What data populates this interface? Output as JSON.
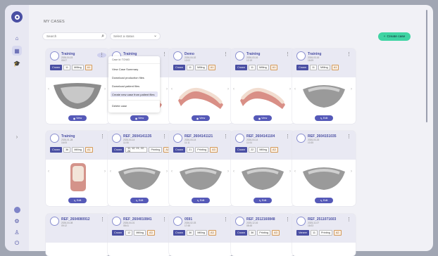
{
  "page": {
    "title": "MY CASES"
  },
  "toolbar": {
    "search_placeholder": "Search",
    "status_placeholder": "Select a status",
    "create_label": "Create case"
  },
  "sidebar": {
    "top_icons": [
      "home-icon",
      "grid-icon",
      "graduation-icon"
    ],
    "bottom_icons": [
      "avatar-icon",
      "settings-icon",
      "user-icon",
      "power-icon"
    ],
    "collapse_icon": "chevron-right-icon"
  },
  "context_menu": {
    "case_id": "Case id: TCN63",
    "items": [
      "View Case Summary",
      "Download production files",
      "Download patient files",
      "Create new case from patient files",
      "Delete case"
    ]
  },
  "cards": [
    {
      "name": "Training",
      "date": "2026-04-15\n09:07",
      "tags": [
        [
          "Crown",
          "dark"
        ],
        [
          "11",
          ""
        ],
        [
          "Milling",
          ""
        ],
        [
          "A1",
          "amber"
        ]
      ],
      "button": "View",
      "scan": "arch"
    },
    {
      "name": "Training",
      "date": "2026-04-15\n09:07",
      "tags": [],
      "button": "View",
      "scan": "teeth"
    },
    {
      "name": "Demo",
      "date": "2026-04-02\n12:02",
      "tags": [
        [
          "Crown",
          "dark"
        ],
        [
          "11",
          ""
        ],
        [
          "Milling",
          ""
        ],
        [
          "A1",
          "amber"
        ]
      ],
      "button": "View",
      "scan": "teeth"
    },
    {
      "name": "Training",
      "date": "2026-03-16\n12:19",
      "tags": [
        [
          "Crown",
          "dark"
        ],
        [
          "11",
          ""
        ],
        [
          "Milling",
          ""
        ],
        [
          "A1",
          "amber"
        ]
      ],
      "button": "View",
      "scan": "teeth"
    },
    {
      "name": "Training",
      "date": "2026-03-16\n16:09",
      "tags": [
        [
          "Crown",
          "dark"
        ],
        [
          "11",
          ""
        ],
        [
          "Milling",
          ""
        ],
        [
          "A1",
          "amber"
        ]
      ],
      "button": "Edit",
      "scan": "grey"
    },
    {
      "name": "Training",
      "date": "2026-01-28\n16:05",
      "tags": [
        [
          "Crown",
          "dark"
        ],
        [
          "36",
          ""
        ],
        [
          "Milling",
          ""
        ],
        [
          "A1",
          "amber"
        ]
      ],
      "button": "Edit",
      "scan": "tooth"
    },
    {
      "name": "REF_2604141135",
      "date": "2026-04-14\n11:06",
      "tags": [
        [
          "Crown",
          "dark"
        ],
        [
          "11, 12, 21, 22, 26",
          ""
        ],
        [
          "Printing",
          ""
        ],
        [
          "A2",
          "amber"
        ]
      ],
      "button": "Edit",
      "scan": "grey"
    },
    {
      "name": "REF_2604141121",
      "date": "2026-04-14\n11:11",
      "tags": [
        [
          "Crown",
          "dark"
        ],
        [
          "21",
          ""
        ],
        [
          "Printing",
          ""
        ],
        [
          "A3",
          "amber"
        ]
      ],
      "button": "Edit",
      "scan": "grey"
    },
    {
      "name": "REF_2604141104",
      "date": "2026-04-14\n11:04",
      "tags": [
        [
          "Crown",
          "dark"
        ],
        [
          "22",
          ""
        ],
        [
          "Milling",
          ""
        ],
        [
          "A3",
          "amber"
        ]
      ],
      "button": "Edit",
      "scan": "grey"
    },
    {
      "name": "REF_2604151035",
      "date": "2026-04-15\n10:35",
      "tags": [],
      "button": "Edit",
      "scan": "grey"
    },
    {
      "name": "REF_2604080912",
      "date": "2026-04-08\n09:12",
      "tags": [],
      "button": "",
      "scan": ""
    },
    {
      "name": "REF_2604010841",
      "date": "2026-04-01\n08:41",
      "tags": [
        [
          "Crown",
          "dark"
        ],
        [
          "12",
          ""
        ],
        [
          "Milling",
          ""
        ],
        [
          "A3",
          "amber"
        ]
      ],
      "button": "",
      "scan": ""
    },
    {
      "name": "0591",
      "date": "2026-02-03\n17:48",
      "tags": [
        [
          "Crown",
          "dark"
        ],
        [
          "36",
          ""
        ],
        [
          "Milling",
          ""
        ],
        [
          "A3",
          "amber"
        ]
      ],
      "button": "",
      "scan": ""
    },
    {
      "name": "REF_2512160848",
      "date": "2025-12-16\n08:48",
      "tags": [
        [
          "Crown",
          "dark"
        ],
        [
          "36",
          ""
        ],
        [
          "Printing",
          ""
        ],
        [
          "A3",
          "amber"
        ]
      ],
      "button": "",
      "scan": ""
    },
    {
      "name": "REF_2511071603",
      "date": "2025-11-07\n16:03",
      "tags": [
        [
          "Veneer",
          "dark"
        ],
        [
          "11",
          ""
        ],
        [
          "Printing",
          ""
        ],
        [
          "A2",
          "amber"
        ]
      ],
      "button": "",
      "scan": ""
    }
  ]
}
